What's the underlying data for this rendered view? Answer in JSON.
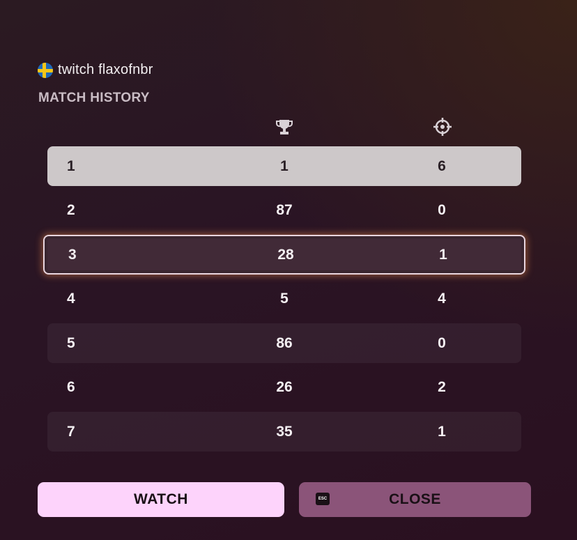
{
  "player": {
    "name": "twitch flaxofnbr",
    "flag_icon": "sweden-flag-icon"
  },
  "section_title": "MATCH HISTORY",
  "columns": {
    "placement_icon": "trophy-icon",
    "eliminations_icon": "crosshair-icon"
  },
  "rows": [
    {
      "index": "1",
      "placement": "1",
      "eliminations": "6"
    },
    {
      "index": "2",
      "placement": "87",
      "eliminations": "0"
    },
    {
      "index": "3",
      "placement": "28",
      "eliminations": "1"
    },
    {
      "index": "4",
      "placement": "5",
      "eliminations": "4"
    },
    {
      "index": "5",
      "placement": "86",
      "eliminations": "0"
    },
    {
      "index": "6",
      "placement": "26",
      "eliminations": "2"
    },
    {
      "index": "7",
      "placement": "35",
      "eliminations": "1"
    }
  ],
  "selected_row": 3,
  "buttons": {
    "watch": "WATCH",
    "close": "CLOSE",
    "esc_key": "ESC"
  },
  "colors": {
    "watch_bg": "#fdd3fb",
    "close_bg": "#8b5479",
    "highlight_row_bg": "#cdc8c9"
  }
}
